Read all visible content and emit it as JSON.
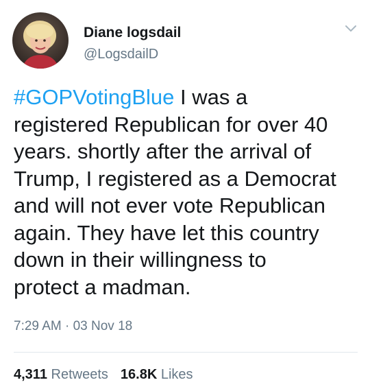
{
  "author": {
    "name": "Diane logsdail",
    "handle": "@LogsdailD"
  },
  "tweet": {
    "hashtag": "#GOPVotingBlue",
    "first_line_rest": " I was a",
    "lines": [
      "registered Republican for over 40",
      "years. shortly after the  arrival of",
      "Trump, I registered as a Democrat",
      "and will not ever vote Republican",
      "again.  They have  let this country",
      "down in their willingness to",
      "protect a madman."
    ],
    "timestamp": "7:29 AM · 03 Nov 18"
  },
  "stats": {
    "retweets_count": "4,311",
    "retweets_label": "Retweets",
    "likes_count": "16.8K",
    "likes_label": "Likes"
  },
  "icons": {
    "menu": "chevron-down-icon",
    "avatar": "profile-photo"
  },
  "colors": {
    "hashtag": "#1da1f2",
    "secondary_text": "#657786",
    "primary_text": "#14171a"
  }
}
